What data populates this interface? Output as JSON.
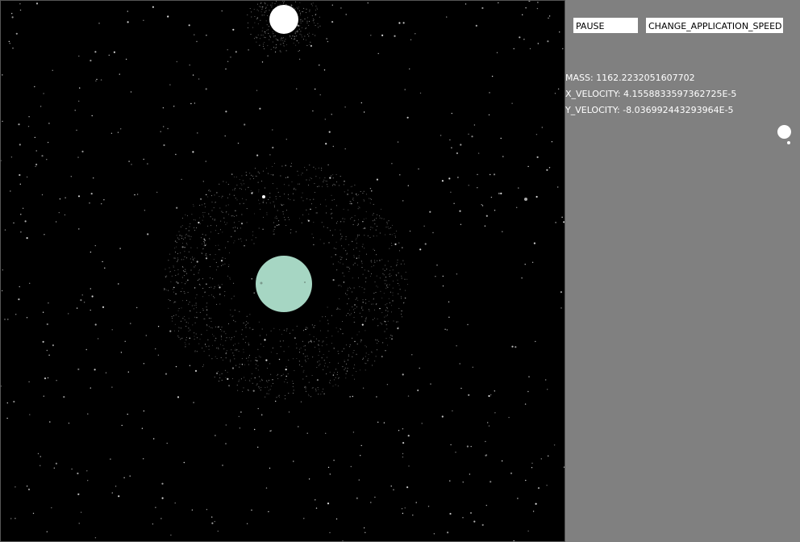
{
  "controls": {
    "pause_label": "PAUSE",
    "speed_label": "CHANGE_APPLICATION_SPEED"
  },
  "selected_body": {
    "mass": "MASS: 1162.2232051607702",
    "x_velocity": "X_VELOCITY: 4.1558833597362725E-5",
    "y_velocity": "Y_VELOCITY: -8.036992443293964E-5"
  },
  "colors": {
    "space": "#000000",
    "panel": "#808080",
    "planet": "#a6d6c3",
    "star": "#ffffff"
  }
}
